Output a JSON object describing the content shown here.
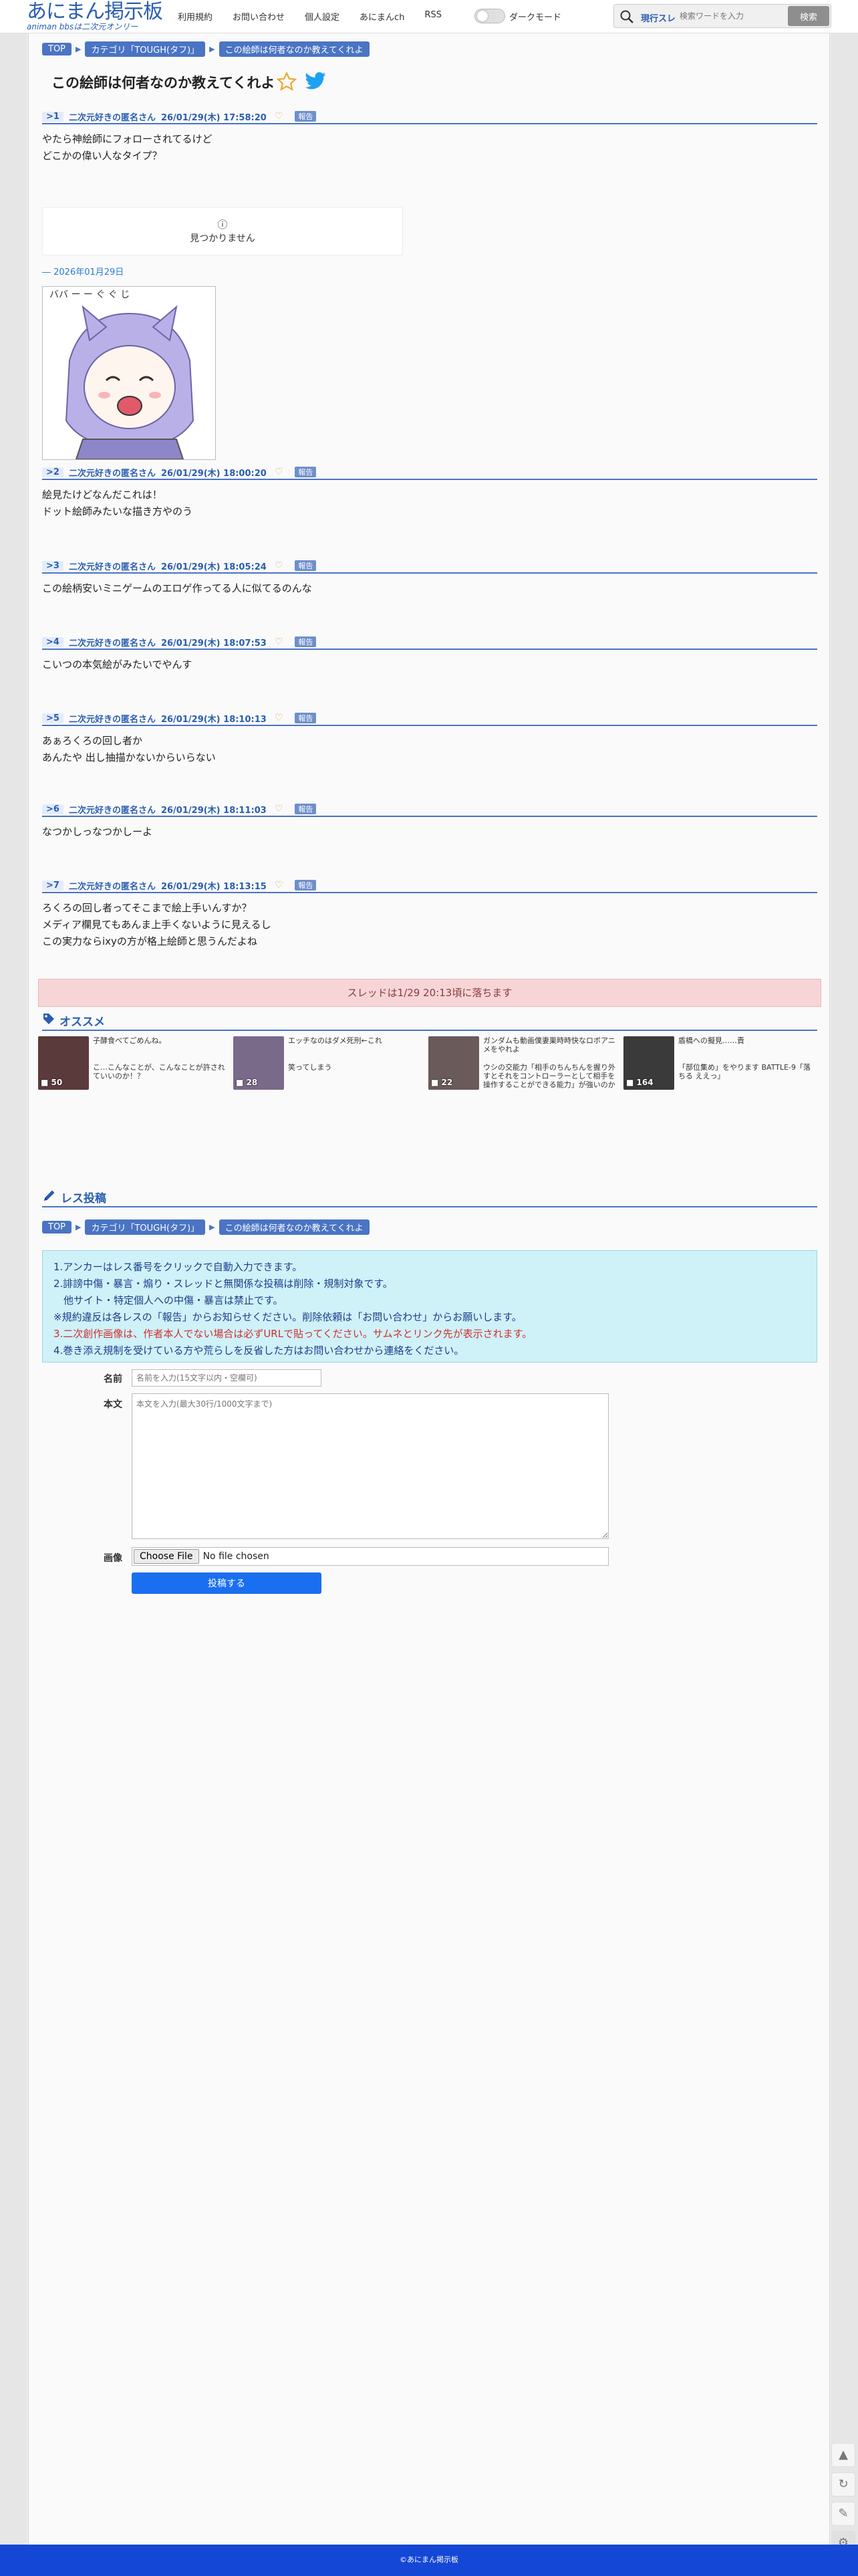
{
  "header": {
    "logo_main": "あにまん掲示板",
    "logo_sub": "animan bbsは二次元オンリー",
    "nav": [
      "利用規約",
      "お問い合わせ",
      "個人設定",
      "あにまんch",
      "RSS"
    ],
    "dark_mode_label": "ダークモード",
    "search_type": "現行スレ",
    "search_placeholder": "検索ワードを入力",
    "search_button": "検索"
  },
  "breadcrumb": [
    "TOP",
    "カテゴリ「TOUGH(タフ)」",
    "この絵師は何者なのか教えてくれよ"
  ],
  "thread_title": "この絵師は何者なのか教えてくれよ",
  "posts": [
    {
      "num": ">1",
      "name": "二次元好きの匿名さん",
      "date": "26/01/29(木) 17:58:20",
      "report": "報告",
      "lines": [
        "やたら神絵師にフォローされてるけど",
        "どこかの偉い人なタイプ？"
      ]
    },
    {
      "num": ">2",
      "name": "二次元好きの匿名さん",
      "date": "26/01/29(木) 18:00:20",
      "report": "報告",
      "lines": [
        "絵見たけどなんだこれは！",
        "ドット絵師みたいな描き方やのう"
      ]
    },
    {
      "num": ">3",
      "name": "二次元好きの匿名さん",
      "date": "26/01/29(木) 18:05:24",
      "report": "報告",
      "lines": [
        "この絵柄安いミニゲームのエロゲ作ってる人に似てるのんな"
      ]
    },
    {
      "num": ">4",
      "name": "二次元好きの匿名さん",
      "date": "26/01/29(木) 18:07:53",
      "report": "報告",
      "lines": [
        "こいつの本気絵がみたいでやんす"
      ]
    },
    {
      "num": ">5",
      "name": "二次元好きの匿名さん",
      "date": "26/01/29(木) 18:10:13",
      "report": "報告",
      "lines": [
        "あぁろくろの回し者か",
        "あんたや 出し抽描かないからいらない"
      ]
    },
    {
      "num": ">6",
      "name": "二次元好きの匿名さん",
      "date": "26/01/29(木) 18:11:03",
      "report": "報告",
      "lines": [
        "なつかしっなつかしーよ"
      ]
    },
    {
      "num": ">7",
      "name": "二次元好きの匿名さん",
      "date": "26/01/29(木) 18:13:15",
      "report": "報告",
      "lines": [
        "ろくろの回し者ってそこまで絵上手いんすか？",
        "メディア欄見てもあんま上手くないように見えるし",
        "この実力ならixyの方が格上絵師と思うんだよね"
      ]
    }
  ],
  "notfound_icon": "info-icon",
  "notfound_text": "見つかりません",
  "image_date": "― 2026年01月29日",
  "closed_banner": "スレッドは1/29 20:13頃に落ちます",
  "recommend": {
    "heading": "オススメ",
    "items": [
      {
        "t1": "子酵食べてごめんね。",
        "t2": "こ…こんなことが、こんなことが許されていいのか！？",
        "count": "50",
        "color": "#5a3a3a"
      },
      {
        "t1": "エッチなのはダメ死刑←これ",
        "t2": "笑ってしまう",
        "count": "28",
        "color": "#7a6a8a"
      },
      {
        "t1": "ガンダムも動画僕妻巣時時快なロボアニメをやれよ",
        "t2": "ウシの交能力「相手のちんちんを握り外すとそれをコントローラーとして相手を操作することができる能力」が強いのか",
        "count": "22",
        "color": "#6a5a5a"
      },
      {
        "t1": "盾橋への擬見……責",
        "t2": "「部位集め」をやります BATTLE-9「落ちる ええっ」",
        "count": "164",
        "color": "#3a3a3a"
      }
    ]
  },
  "post_form": {
    "heading": "レス投稿",
    "notice": [
      "1.アンカーはレス番号をクリックで自動入力できます。",
      "2.誹謗中傷・暴言・煽り・スレッドと無関係な投稿は削除・規制対象です。",
      "　他サイト・特定個人への中傷・暴言は禁止です。",
      "※規約違反は各レスの「報告」からお知らせください。削除依頼は「お問い合わせ」からお願いします。",
      "3.二次創作画像は、作者本人でない場合は必ずURLで貼ってください。サムネとリンク先が表示されます。",
      "4.巻き添え規制を受けている方や荒らしを反省した方はお問い合わせから連絡をください。"
    ],
    "name_label": "名前",
    "name_placeholder": "名前を入力(15文字以内・空欄可)",
    "body_label": "本文",
    "body_placeholder": "本文を入力(最大30行/1000文字まで)",
    "image_label": "画像",
    "file_button": "Choose File",
    "file_status": "No file chosen",
    "submit": "投稿する"
  },
  "footer": "©あにまん掲示板"
}
